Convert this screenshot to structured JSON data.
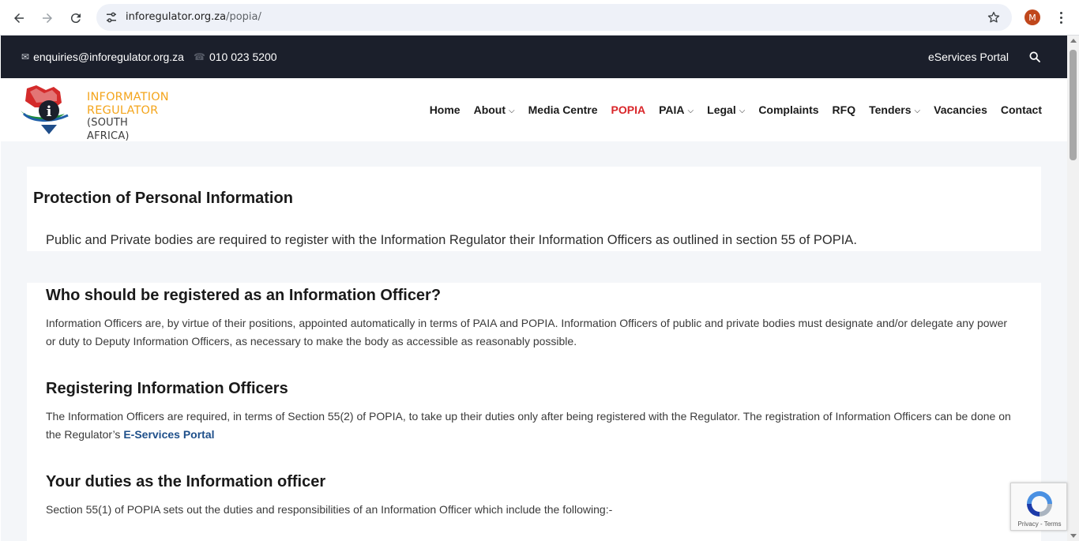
{
  "browser": {
    "url_host": "inforegulator.org.za",
    "url_path": "/popia/",
    "profile_initial": "M",
    "icons": [
      "back-arrow-icon",
      "forward-arrow-icon",
      "reload-icon",
      "site-settings-icon",
      "bookmark-star-icon",
      "more-menu-icon"
    ]
  },
  "topbar": {
    "email": "enquiries@inforegulator.org.za",
    "phone": "010 023 5200",
    "eservices": "eServices Portal"
  },
  "logo": {
    "line1": "INFORMATION",
    "line2": "REGULATOR",
    "line3": "(SOUTH AFRICA)"
  },
  "menu": {
    "items": [
      {
        "label": "Home",
        "dropdown": false
      },
      {
        "label": "About",
        "dropdown": true
      },
      {
        "label": "Media Centre",
        "dropdown": false
      },
      {
        "label": "POPIA",
        "dropdown": false,
        "active": true
      },
      {
        "label": "PAIA",
        "dropdown": true
      },
      {
        "label": "Legal",
        "dropdown": true
      },
      {
        "label": "Complaints",
        "dropdown": false
      },
      {
        "label": "RFQ",
        "dropdown": false
      },
      {
        "label": "Tenders",
        "dropdown": true
      },
      {
        "label": "Vacancies",
        "dropdown": false
      },
      {
        "label": "Contact",
        "dropdown": false
      }
    ]
  },
  "main": {
    "title": "Protection of Personal Information",
    "lead": "Public and Private bodies are required to register with the Information Regulator their Information Officers as outlined in  section 55 of POPIA.",
    "sections": [
      {
        "heading": "Who should be registered as an Information Officer?",
        "text": "Information Officers are, by virtue of their positions, appointed automatically in terms of PAIA and POPIA. Information Officers of public and private bodies must designate and/or delegate any power or duty to Deputy Information Officers, as necessary to make the body as accessible as reasonably possible."
      },
      {
        "heading": "Registering Information Officers",
        "text": "The Information Officers are required, in terms of Section 55(2) of POPIA, to take up their duties only after being registered with the Regulator. The registration of Information Officers can be done on the Regulator’s ",
        "link": "E-Services Portal"
      },
      {
        "heading": "Your duties as the Information officer",
        "text": "Section 55(1) of POPIA sets out the duties and responsibilities of an Information Officer which include the following:-"
      }
    ]
  },
  "recaptcha": {
    "terms": "Privacy - Terms"
  },
  "colors": {
    "topbar_bg": "#1b1f2b",
    "active_menu": "#d9262a",
    "logo_gold": "#f4a51c",
    "link": "#1e4f8a"
  }
}
